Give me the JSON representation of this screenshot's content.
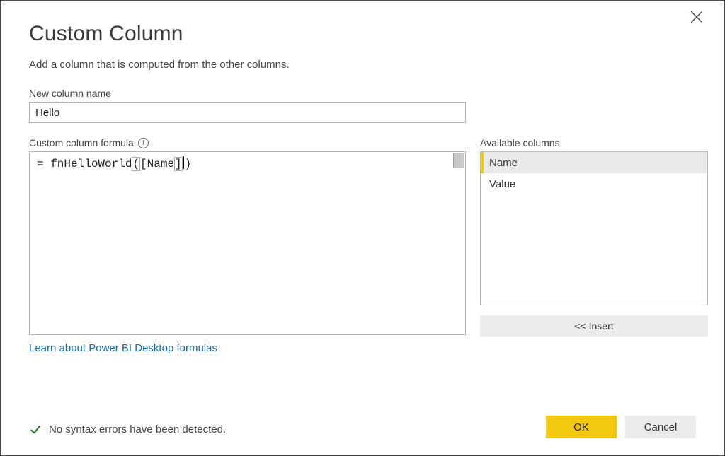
{
  "dialog": {
    "title": "Custom Column",
    "subtitle": "Add a column that is computed from the other columns."
  },
  "column_name": {
    "label": "New column name",
    "value": "Hello"
  },
  "formula": {
    "label": "Custom column formula",
    "prefix": "= ",
    "fn": "fnHelloWorld",
    "open": "(",
    "open_bracket": "[",
    "arg": "Name",
    "close_bracket": "]",
    "close": ")"
  },
  "learn_link": "Learn about Power BI Desktop formulas",
  "available": {
    "label": "Available columns",
    "items": [
      "Name",
      "Value"
    ],
    "selected_index": 0
  },
  "insert_button": "<< Insert",
  "status": {
    "text": "No syntax errors have been detected."
  },
  "actions": {
    "ok": "OK",
    "cancel": "Cancel"
  }
}
